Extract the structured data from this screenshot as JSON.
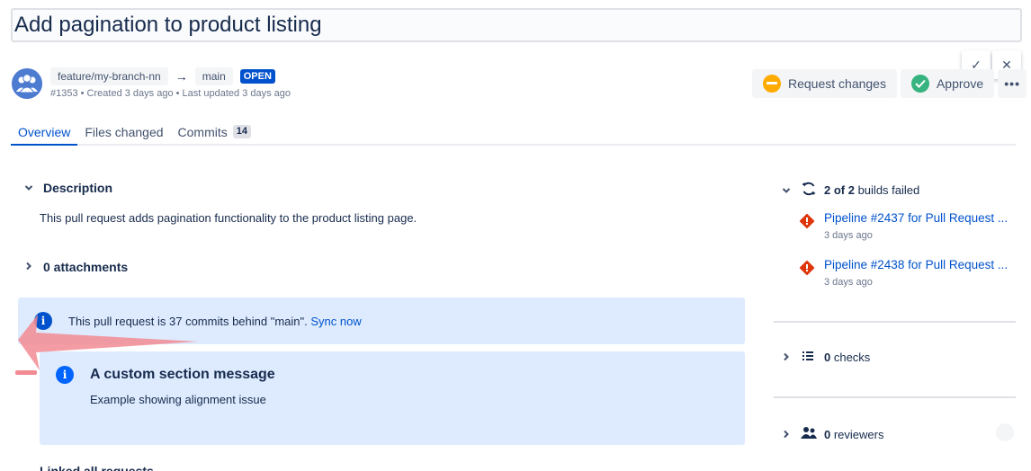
{
  "pr": {
    "title": "Add pagination to product listing",
    "source_branch": "feature/my-branch-nn",
    "target_branch": "main",
    "status": "OPEN",
    "meta": "#1353 • Created 3 days ago • Last updated 3 days ago"
  },
  "actions": {
    "request_changes": "Request changes",
    "approve": "Approve",
    "more": "•••"
  },
  "tabs": [
    {
      "label": "Overview"
    },
    {
      "label": "Files changed"
    },
    {
      "label": "Commits",
      "count": "14"
    }
  ],
  "description": {
    "heading": "Description",
    "text": "This pull request adds pagination functionality to the product listing page."
  },
  "attachments": {
    "label": "0 attachments"
  },
  "sync_banner": {
    "text": "This pull request is 37 commits behind \"main\". ",
    "link": "Sync now"
  },
  "section_message": {
    "title": "A custom section message",
    "body": "Example showing alignment issue"
  },
  "linked_heading": "Linked all requests",
  "builds": {
    "summary_bold": "2 of 2",
    "summary_rest": " builds failed",
    "items": [
      {
        "title": "Pipeline #2437 for Pull Request ...",
        "time": "3 days ago"
      },
      {
        "title": "Pipeline #2438 for Pull Request ...",
        "time": "3 days ago"
      }
    ]
  },
  "checks": {
    "count": "0",
    "label": " checks"
  },
  "reviewers": {
    "count": "0",
    "label": " reviewers"
  },
  "colors": {
    "primary": "#0052cc",
    "info_bg": "#deebff",
    "warning": "#ffab00",
    "success": "#36b37e",
    "danger": "#de350b",
    "annotation": "#f28b93"
  }
}
